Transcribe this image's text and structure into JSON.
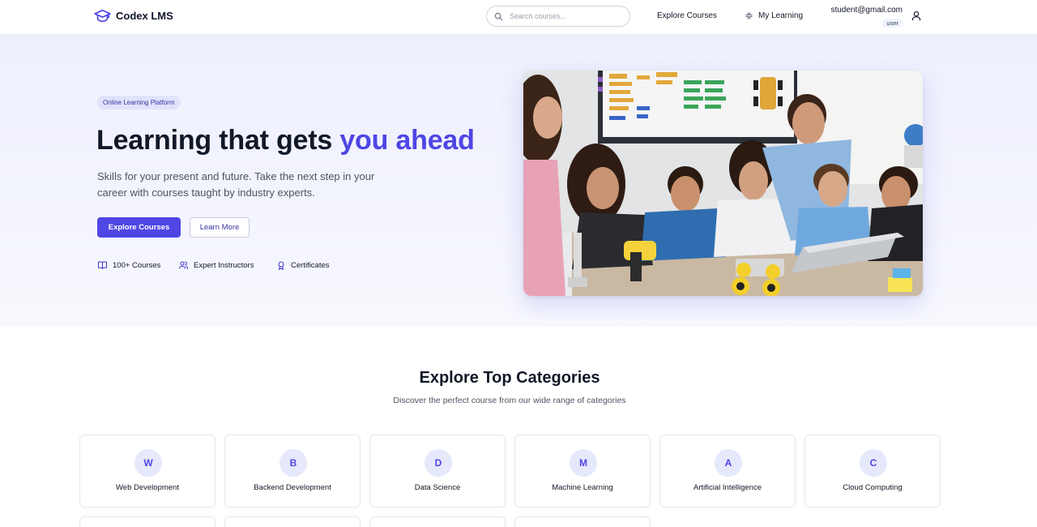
{
  "nav": {
    "logo_text": "Codex LMS",
    "search_placeholder": "Search courses...",
    "explore_label": "Explore Courses",
    "my_learning_label": "My Learning",
    "user_email": "student@gmail.com",
    "user_role": "user"
  },
  "hero": {
    "badge": "Online Learning Platform",
    "title_main": "Learning that gets ",
    "title_accent": "you ahead",
    "subtitle": "Skills for your present and future. Take the next step in your career with courses taught by industry experts.",
    "primary_button": "Explore Courses",
    "secondary_button": "Learn More",
    "features": [
      {
        "label": "100+ Courses",
        "icon": "book-open-icon"
      },
      {
        "label": "Expert Instructors",
        "icon": "users-icon"
      },
      {
        "label": "Certificates",
        "icon": "award-icon"
      }
    ]
  },
  "categories": {
    "title": "Explore Top Categories",
    "subtitle": "Discover the perfect course from our wide range of categories",
    "items": [
      {
        "letter": "W",
        "name": "Web Development"
      },
      {
        "letter": "B",
        "name": "Backend Development"
      },
      {
        "letter": "D",
        "name": "Data Science"
      },
      {
        "letter": "M",
        "name": "Machine Learning"
      },
      {
        "letter": "A",
        "name": "Artificial Intelligence"
      },
      {
        "letter": "C",
        "name": "Cloud Computing"
      }
    ]
  },
  "colors": {
    "accent": "#4f46e5",
    "accent_light": "#e6e8fb",
    "text_dark": "#111827",
    "text_muted": "#4b5563"
  }
}
